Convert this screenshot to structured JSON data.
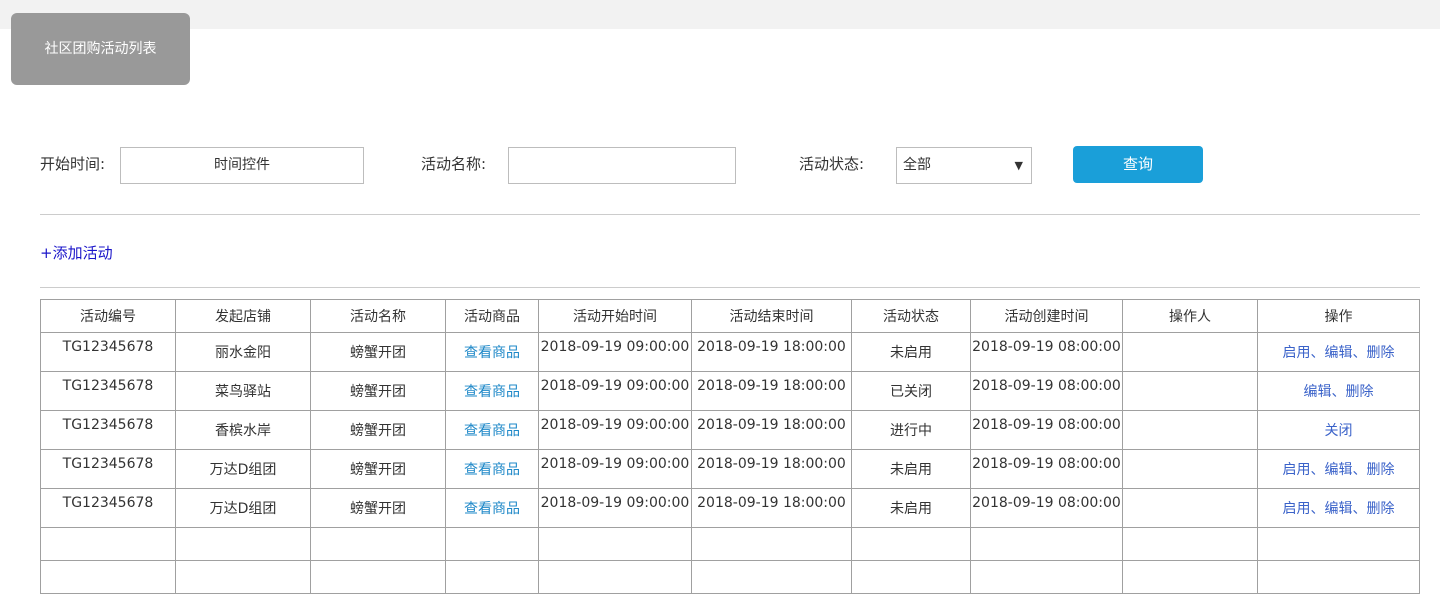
{
  "page": {
    "tab_title": "社区团购活动列表"
  },
  "filters": {
    "start_time_label": "开始时间:",
    "start_time_value": "时间控件",
    "name_label": "活动名称:",
    "name_value": "",
    "status_label": "活动状态:",
    "status_value": "全部",
    "query_button": "查询"
  },
  "add_link": "+添加活动",
  "table": {
    "headers": [
      "活动编号",
      "发起店铺",
      "活动名称",
      "活动商品",
      "活动开始时间",
      "活动结束时间",
      "活动状态",
      "活动创建时间",
      "操作人",
      "操作"
    ],
    "rows": [
      [
        "TG12345678",
        "丽水金阳",
        "螃蟹开团",
        "查看商品",
        "2018-09-19 09:00:00",
        "2018-09-19 18:00:00",
        "未启用",
        "2018-09-19 08:00:00",
        "",
        "启用、编辑、删除"
      ],
      [
        "TG12345678",
        "菜鸟驿站",
        "螃蟹开团",
        "查看商品",
        "2018-09-19 09:00:00",
        "2018-09-19 18:00:00",
        "已关闭",
        "2018-09-19 08:00:00",
        "",
        "编辑、删除"
      ],
      [
        "TG12345678",
        "香槟水岸",
        "螃蟹开团",
        "查看商品",
        "2018-09-19 09:00:00",
        "2018-09-19 18:00:00",
        "进行中",
        "2018-09-19 08:00:00",
        "",
        "关闭"
      ],
      [
        "TG12345678",
        "万达D组团",
        "螃蟹开团",
        "查看商品",
        "2018-09-19 09:00:00",
        "2018-09-19 18:00:00",
        "未启用",
        "2018-09-19 08:00:00",
        "",
        "启用、编辑、删除"
      ],
      [
        "TG12345678",
        "万达D组团",
        "螃蟹开团",
        "查看商品",
        "2018-09-19 09:00:00",
        "2018-09-19 18:00:00",
        "未启用",
        "2018-09-19 08:00:00",
        "",
        "启用、编辑、删除"
      ]
    ],
    "empty_rows": 2
  }
}
